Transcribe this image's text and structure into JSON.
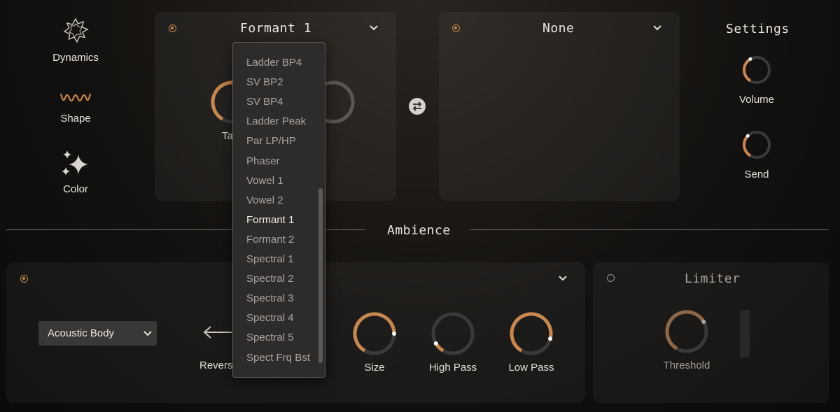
{
  "nav": {
    "dynamics": "Dynamics",
    "shape": "Shape",
    "color": "Color"
  },
  "filter_a": {
    "title": "Formant 1",
    "partial_label": "Ta",
    "knob_level": 0.7
  },
  "filter_b": {
    "title": "None"
  },
  "settings": {
    "title": "Settings",
    "volume_label": "Volume",
    "send_label": "Send",
    "volume_level": 0.4,
    "send_level": 0.35
  },
  "dropdown": {
    "items": [
      "Ladder BP4",
      "SV BP2",
      "SV BP4",
      "Ladder Peak",
      "Par LP/HP",
      "Phaser",
      "Vowel 1",
      "Vowel 2",
      "Formant 1",
      "Formant 2",
      "Spectral 1",
      "Spectral 2",
      "Spectral 3",
      "Spectral 4",
      "Spectral 5",
      "Spect Frq Bst"
    ],
    "selected": "Formant 1"
  },
  "ambience": {
    "title": "Ambience",
    "preset": "Acoustic Body",
    "reverse_label": "Revers",
    "size_label": "Size",
    "high_pass_label": "High Pass",
    "low_pass_label": "Low Pass",
    "size_level": 0.8,
    "high_pass_level": 0.1,
    "low_pass_level": 0.85
  },
  "limiter": {
    "title": "Limiter",
    "threshold_label": "Threshold",
    "threshold_level": 0.7
  },
  "colors": {
    "accent": "#c7874f",
    "track": "#3c3a38"
  }
}
